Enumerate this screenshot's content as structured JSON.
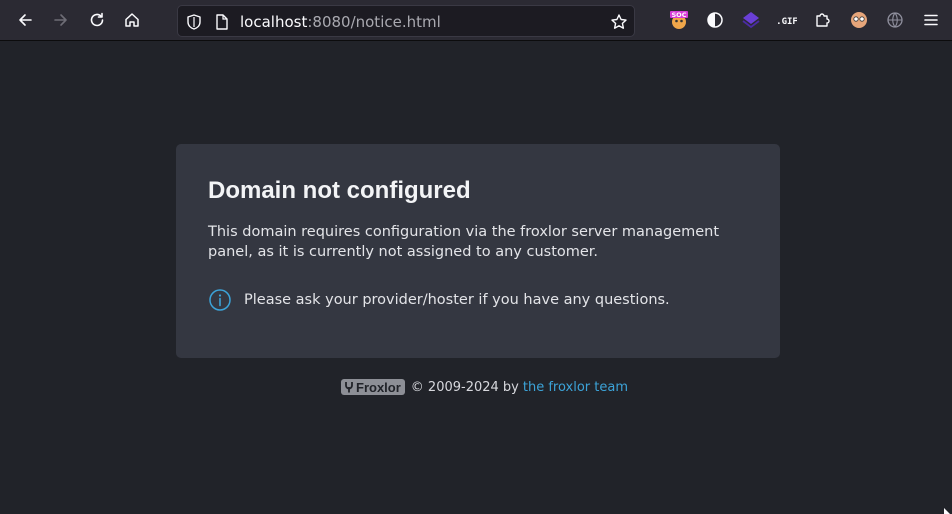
{
  "browser": {
    "url_host": "localhost",
    "url_rest": ":8080/notice.html",
    "buttons": {
      "back": "back-arrow-icon",
      "forward": "forward-arrow-icon",
      "reload": "reload-icon",
      "home": "home-icon"
    },
    "extensions": [
      "soc-extension-icon",
      "dark-reader-icon",
      "layers-extension-icon",
      "gif-extension-icon",
      "puzzle-extensions-icon",
      "avatar-extension-icon",
      "globe-extension-icon",
      "menu-icon"
    ]
  },
  "card": {
    "title": "Domain not configured",
    "body": "This domain requires configuration via the froxlor server management panel, as it is currently not assigned to any customer.",
    "info": "Please ask your provider/hoster if you have any questions."
  },
  "footer": {
    "logo_text": "Froxlor",
    "copyright": "© 2009-2024 by",
    "link_text": "the froxlor team"
  },
  "colors": {
    "background": "#212329",
    "card": "#343741",
    "link": "#3ca3d8",
    "toolbar": "#2b2a33"
  }
}
